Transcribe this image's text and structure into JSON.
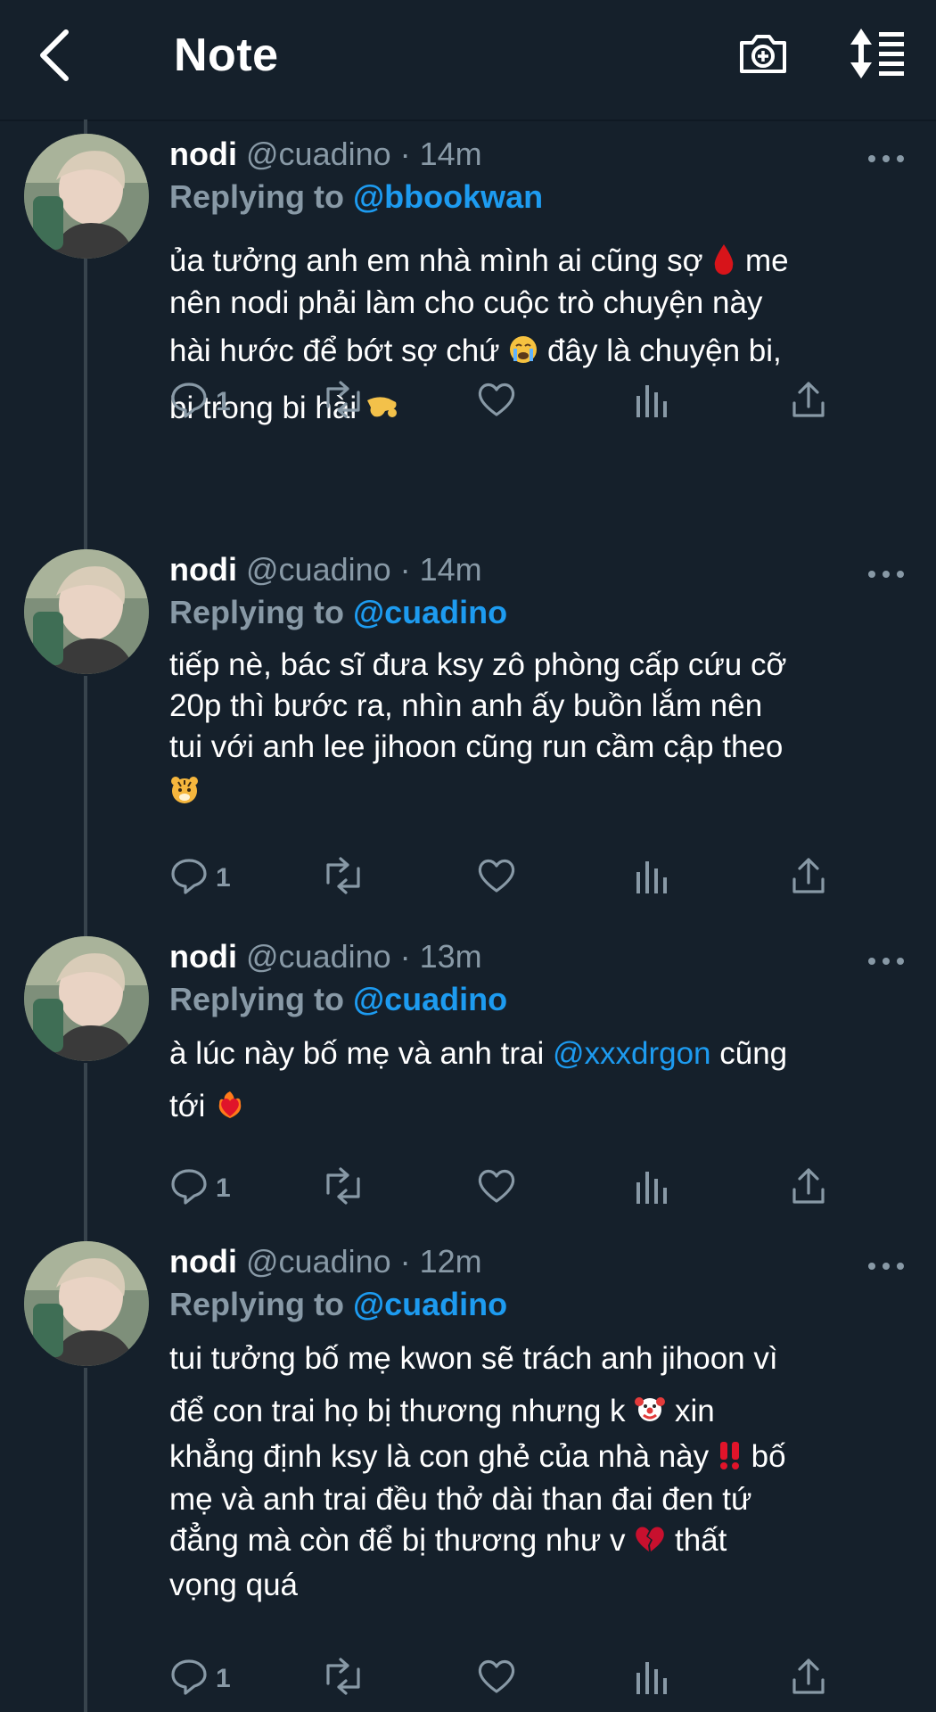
{
  "header": {
    "title": "Note"
  },
  "tweets": [
    {
      "name": "nodi",
      "handle_time": "@cuadino · 14m",
      "replying_prefix": "Replying to",
      "replying_to": "@bbookwan",
      "lines": [
        [
          "ủa tưởng anh em nhà mình ai cũng sợ ",
          " me"
        ],
        [
          "nên nodi phải làm cho cuộc trò chuyện này"
        ],
        [
          "hài hước để bớt sợ chứ ",
          "  đây là chuyện bi,"
        ],
        [
          "bi trong bi hài "
        ]
      ],
      "reply_count": "1"
    },
    {
      "name": "nodi",
      "handle_time": "@cuadino · 14m",
      "replying_prefix": "Replying to",
      "replying_to": "@cuadino",
      "lines": [
        [
          "tiếp nè, bác sĩ đưa ksy zô phòng cấp cứu cỡ"
        ],
        [
          "20p thì bước ra, nhìn anh ấy buồn lắm nên"
        ],
        [
          "tui với anh lee jihoon cũng run cầm cập theo"
        ]
      ],
      "reply_count": "1"
    },
    {
      "name": "nodi",
      "handle_time": "@cuadino · 13m",
      "replying_prefix": "Replying to",
      "replying_to": "@cuadino",
      "lines": [
        [
          "à lúc này bố mẹ và anh trai ",
          "@xxxdrgon",
          " cũng"
        ],
        [
          "tới "
        ]
      ],
      "reply_count": "1"
    },
    {
      "name": "nodi",
      "handle_time": "@cuadino · 12m",
      "replying_prefix": "Replying to",
      "replying_to": "@cuadino",
      "lines": [
        [
          "tui tưởng bố mẹ kwon sẽ trách anh jihoon vì"
        ],
        [
          "để con trai họ bị thương nhưng k ",
          "  xin"
        ],
        [
          "khẳng định ksy là con ghẻ của nhà này ",
          "  bố"
        ],
        [
          "mẹ và anh trai đều thở dài than đai đen tứ"
        ],
        [
          "đẳng mà còn để bị thương như v ",
          "  thất"
        ],
        [
          "vọng quá"
        ]
      ],
      "reply_count": "1"
    }
  ],
  "icons": {
    "reply": "reply-icon",
    "retweet": "retweet-icon",
    "like": "heart-icon",
    "analytics": "analytics-icon",
    "share": "share-icon"
  },
  "colors": {
    "background": "#15202b",
    "accent": "#1d9bf0",
    "muted": "#8899a6"
  }
}
